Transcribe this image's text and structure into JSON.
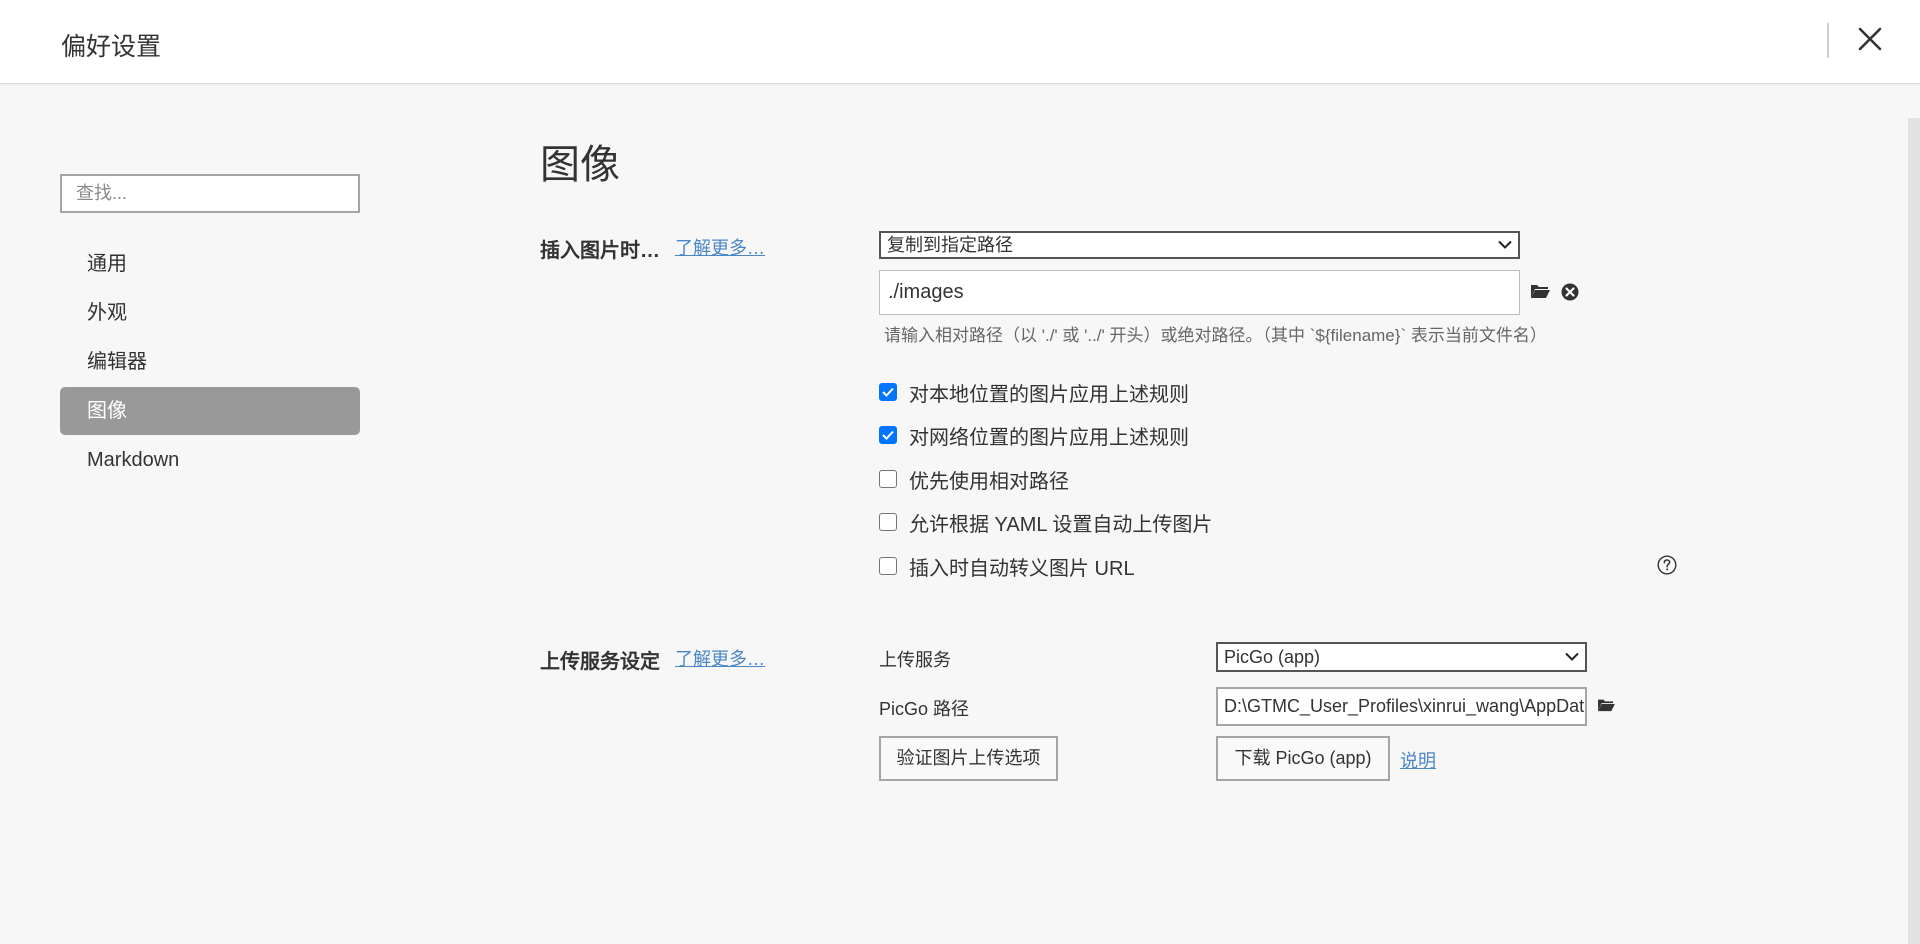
{
  "window": {
    "title": "偏好设置"
  },
  "sidebar": {
    "search_placeholder": "查找...",
    "items": [
      {
        "label": "通用"
      },
      {
        "label": "外观"
      },
      {
        "label": "编辑器"
      },
      {
        "label": "图像",
        "active": true
      },
      {
        "label": "Markdown"
      }
    ]
  },
  "main": {
    "section_title": "图像",
    "insert": {
      "label": "插入图片时…",
      "learn_more": "了解更多…",
      "action_select": "复制到指定路径",
      "path_value": "./images",
      "path_hint": "请输入相对路径（以 './' 或 '../' 开头）或绝对路径。（其中 `${filename}` 表示当前文件名）",
      "options": [
        {
          "label": "对本地位置的图片应用上述规则",
          "checked": true
        },
        {
          "label": "对网络位置的图片应用上述规则",
          "checked": true
        },
        {
          "label": "优先使用相对路径",
          "checked": false
        },
        {
          "label": "允许根据 YAML 设置自动上传图片",
          "checked": false
        },
        {
          "label": "插入时自动转义图片 URL",
          "checked": false
        }
      ]
    },
    "upload": {
      "label": "上传服务设定",
      "learn_more": "了解更多…",
      "service_label": "上传服务",
      "service_value": "PicGo (app)",
      "path_label": "PicGo 路径",
      "path_value": "D:\\GTMC_User_Profiles\\xinrui_wang\\AppData",
      "verify_button": "验证图片上传选项",
      "download_button": "下载 PicGo (app)",
      "docs_link": "说明"
    }
  },
  "icons": {
    "close": "close-icon",
    "folder": "folder-icon",
    "clear": "clear-icon",
    "help": "help-icon",
    "dropdown": "chevron-down-icon"
  },
  "colors": {
    "active_nav_bg": "#999999",
    "link": "#4a87c6",
    "checkbox_checked": "#0075ff"
  }
}
